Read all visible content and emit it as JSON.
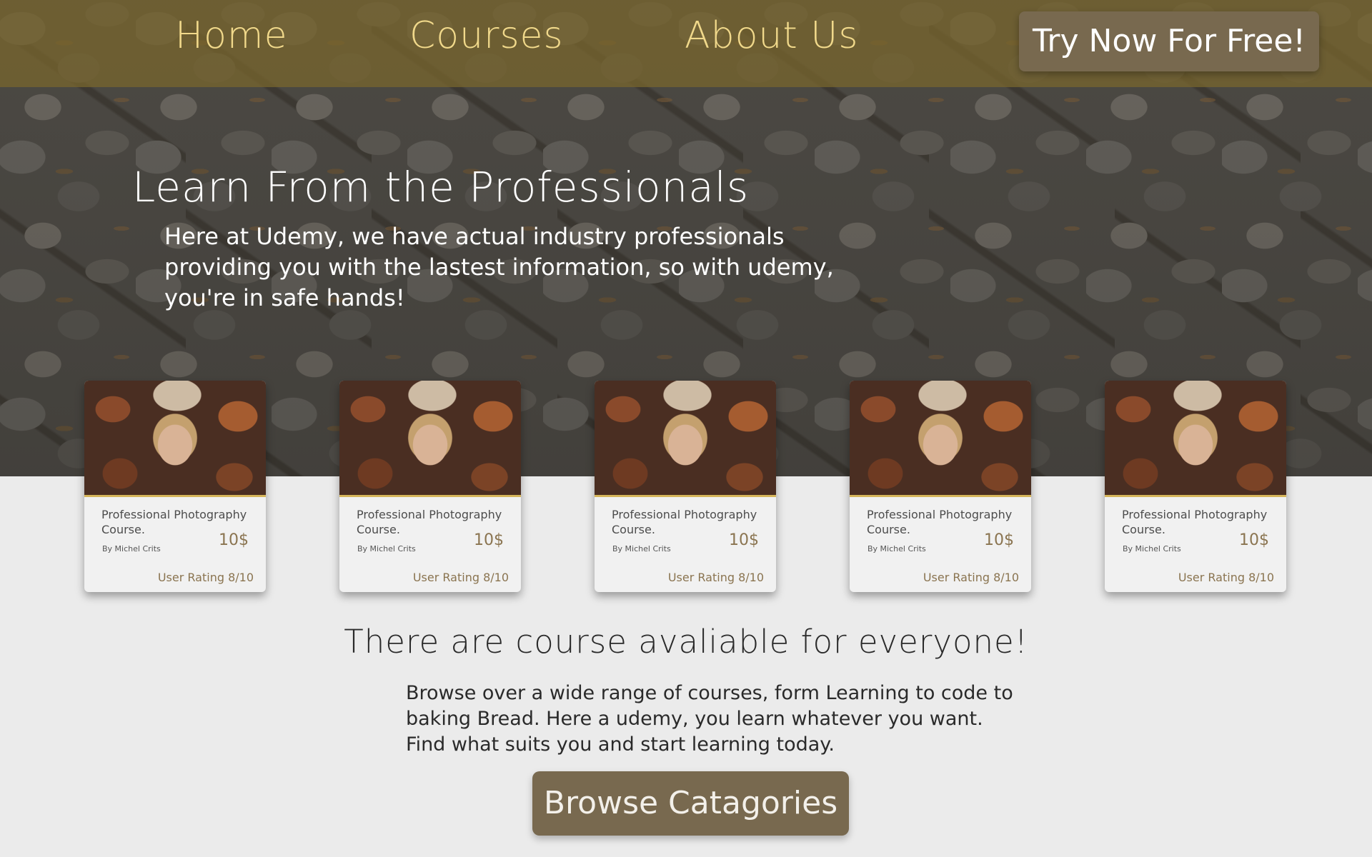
{
  "nav": {
    "links": [
      "Home",
      "Courses",
      "About Us"
    ],
    "cta_label": "Try Now For Free!"
  },
  "hero": {
    "title": "Learn From the Professionals",
    "text": "Here at Udemy, we have actual industry professionals providing you with the lastest information, so with udemy, you're in safe hands!"
  },
  "courses": [
    {
      "title": "Professional Photography Course.",
      "author": "By Michel Crits",
      "price": "10$",
      "rating": "User Rating 8/10"
    },
    {
      "title": "Professional Photography Course.",
      "author": "By Michel Crits",
      "price": "10$",
      "rating": "User Rating 8/10"
    },
    {
      "title": "Professional Photography Course.",
      "author": "By Michel Crits",
      "price": "10$",
      "rating": "User Rating 8/10"
    },
    {
      "title": "Professional Photography Course.",
      "author": "By Michel Crits",
      "price": "10$",
      "rating": "User Rating 8/10"
    },
    {
      "title": "Professional Photography Course.",
      "author": "By Michel Crits",
      "price": "10$",
      "rating": "User Rating 8/10"
    }
  ],
  "section": {
    "title": "There are course avaliable for everyone!",
    "text": "Browse over a wide range of courses, form Learning to code to baking Bread. Here a udemy, you learn whatever you want. Find what suits you and start learning today.",
    "button_label": "Browse Catagories"
  },
  "colors": {
    "nav_bg": "#7a662c",
    "nav_text": "#f1d98b",
    "button_bg": "#78694f",
    "page_bg": "#ebebeb",
    "accent_text": "#8a7450"
  }
}
